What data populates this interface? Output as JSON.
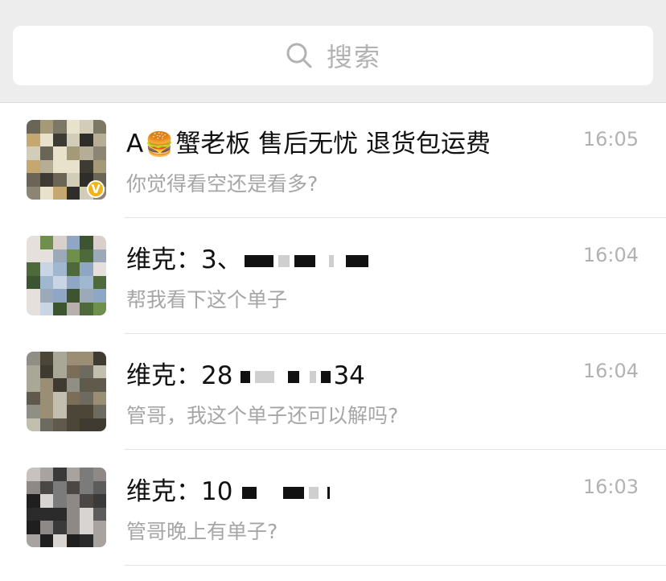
{
  "search": {
    "placeholder": "搜索"
  },
  "chats": [
    {
      "title_prefix": "A",
      "title_emoji": "🍔",
      "title_rest": "蟹老板 售后无忧 退货包运费",
      "time": "16:05",
      "preview": "你觉得看空还是看多?",
      "verified_badge": "V"
    },
    {
      "title_prefix": "维克：3、",
      "time": "16:04",
      "preview": "帮我看下这个单子"
    },
    {
      "title_prefix": "维克：28",
      "title_suffix": "34",
      "time": "16:04",
      "preview": "管哥，我这个单子还可以解吗?"
    },
    {
      "title_prefix": "维克：10",
      "time": "16:03",
      "preview": "管哥晚上有单子?"
    }
  ],
  "colors": {
    "header_bg": "#ededed",
    "title": "#111111",
    "secondary_text": "#b2b2b2",
    "badge": "#f2b21a"
  }
}
